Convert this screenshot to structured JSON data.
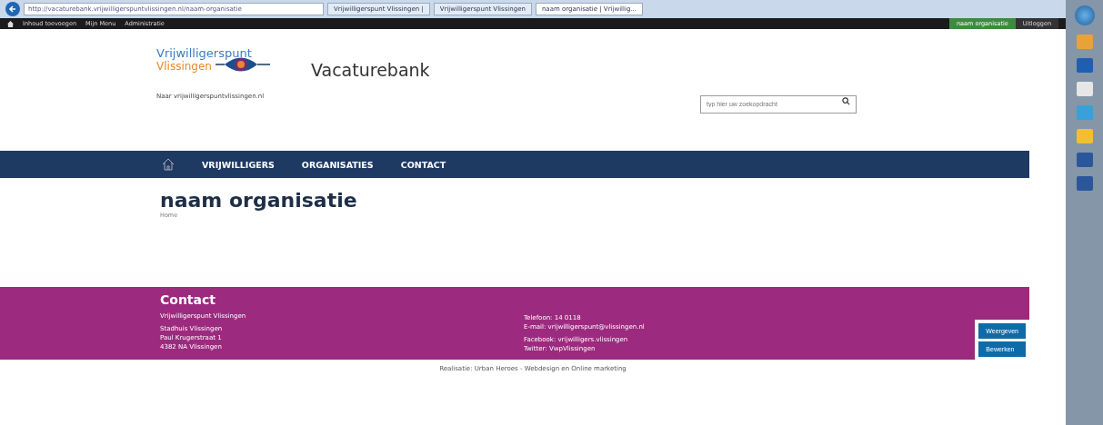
{
  "browser": {
    "address": "http://vacaturebank.vrijwilligerspuntvlissingen.nl/naam-organisatie",
    "tabs": [
      {
        "label": "Vrijwilligerspunt Vlissingen |",
        "selected": false
      },
      {
        "label": "Vrijwilligerspunt Vlissingen",
        "selected": false
      },
      {
        "label": "naam organisatie | Vrijwillig...",
        "selected": true
      }
    ]
  },
  "admin_bar": {
    "left": [
      "Inhoud toevoegen",
      "Mijn Menu",
      "Administratie"
    ],
    "user": "naam organisatie",
    "logout": "Uitloggen"
  },
  "header": {
    "logo_top": "Vrijwilligerspunt",
    "logo_bottom": "Vlissingen",
    "site_title": "Vacaturebank",
    "link": "Naar vrijwilligerspuntvlissingen.nl",
    "search": {
      "placeholder": "typ hier uw zoekopdracht"
    }
  },
  "nav": [
    "VRIJWILLIGERS",
    "ORGANISATIES",
    "CONTACT"
  ],
  "page": {
    "title": "naam organisatie",
    "breadcrumb": "Home"
  },
  "footer": {
    "heading": "Contact",
    "left": [
      [
        "Vrijwilligerspunt Vlissingen"
      ],
      [
        "Stadhuis Vlissingen",
        "Paul Krugerstraat 1",
        "4382 NA Vlissingen"
      ]
    ],
    "right": [
      [
        "Telefoon: 14 0118",
        "E-mail: vrijwilligerspunt@vlissingen.nl"
      ],
      [
        "Facebook: vrijwilligers.vlissingen",
        "Twitter: VwpVlissingen"
      ]
    ]
  },
  "actions": [
    "Weergeven",
    "Bewerken"
  ],
  "credit": "Realisatie: Urban Heroes - Webdesign en Online marketing"
}
